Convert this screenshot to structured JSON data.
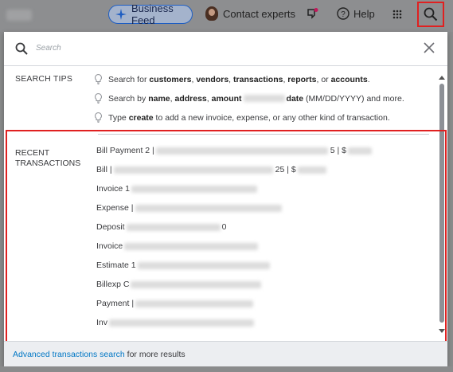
{
  "topbar": {
    "business_feed_label": "Business Feed",
    "contact_label": "Contact experts",
    "help_label": "Help"
  },
  "search": {
    "placeholder": "Search"
  },
  "search_tips": {
    "label": "SEARCH TIPS",
    "tip1": {
      "pre": "Search for ",
      "b1": "customers",
      "s1": ", ",
      "b2": "vendors",
      "s2": ", ",
      "b3": "transactions",
      "s3": ", ",
      "b4": "reports",
      "s4": ", or ",
      "b5": "accounts",
      "post": "."
    },
    "tip2": {
      "pre": "Search by ",
      "b1": "name",
      "s1": ", ",
      "b2": "address",
      "s2": ", ",
      "b3": "amount",
      "b4": "date",
      "post": " (MM/DD/YYYY) and more."
    },
    "tip3": {
      "pre": "Type ",
      "b1": "create",
      "post": " to add a new invoice, expense, or any other kind of transaction."
    }
  },
  "recent": {
    "label_line1": "RECENT",
    "label_line2": "TRANSACTIONS",
    "rows": [
      {
        "label": "Bill Payment 2 |",
        "tail": "5 | $"
      },
      {
        "label": "Bill |",
        "tail": "25 | $"
      },
      {
        "label": "Invoice 1",
        "tail": ""
      },
      {
        "label": "Expense |",
        "tail": ""
      },
      {
        "label": "Deposit",
        "tail": "0"
      },
      {
        "label": "Invoice",
        "tail": ""
      },
      {
        "label": "Estimate 1",
        "tail": ""
      },
      {
        "label": "Billexp C",
        "tail": ""
      },
      {
        "label": "Payment |",
        "tail": ""
      },
      {
        "label": "Inv",
        "tail": ""
      }
    ]
  },
  "footer": {
    "link": "Advanced transactions search",
    "suffix": "for more results"
  },
  "colors": {
    "highlight": "#e02020",
    "link": "#0077c5"
  }
}
